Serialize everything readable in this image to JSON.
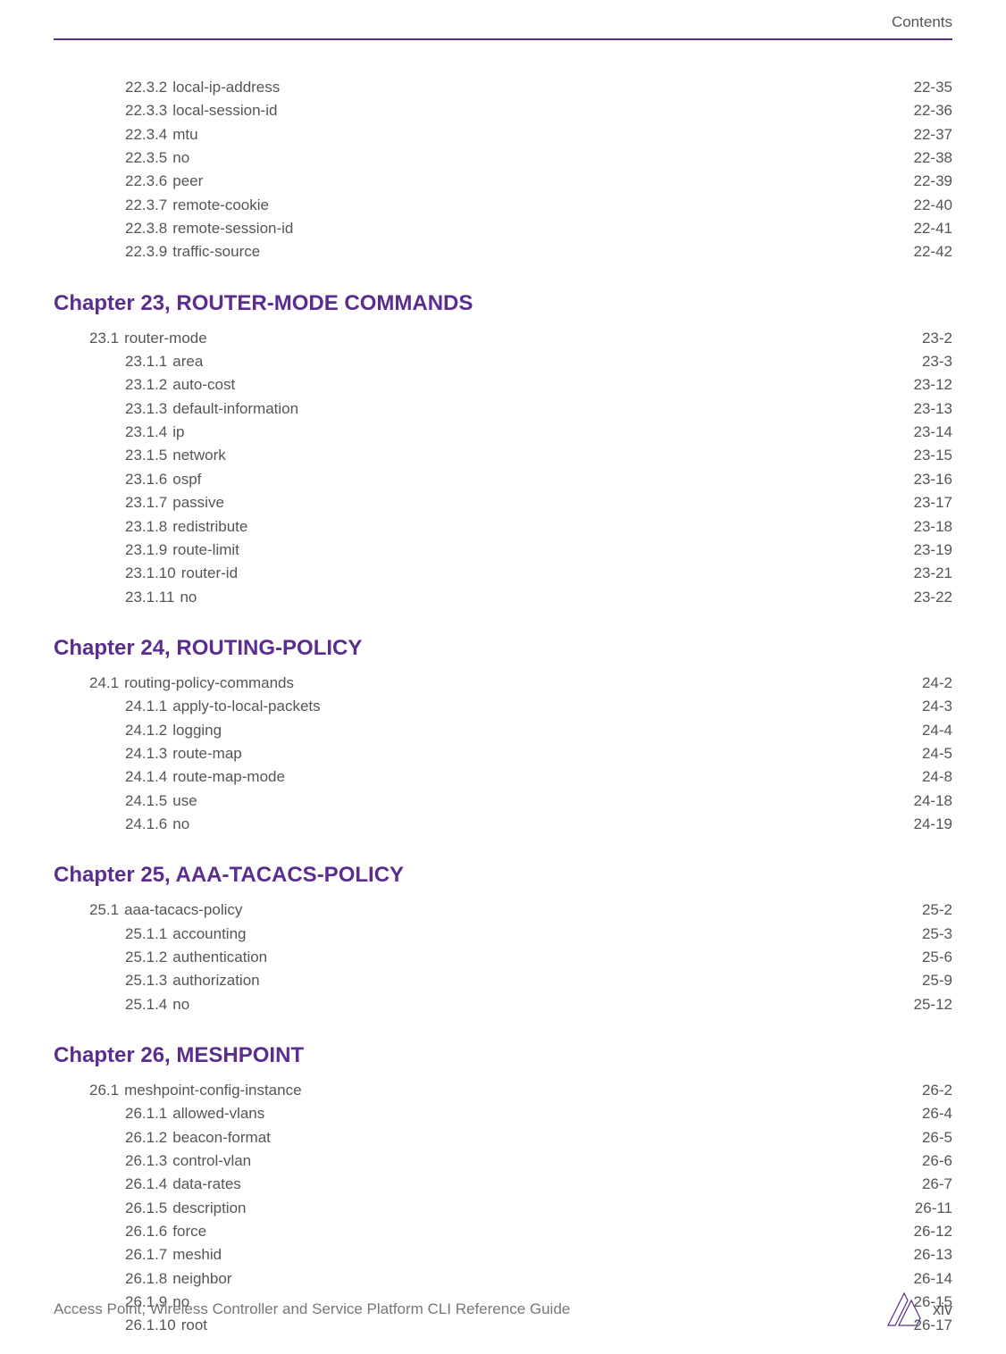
{
  "header": {
    "right": "Contents"
  },
  "footer": {
    "left": "Access Point, Wireless Controller and Service Platform CLI Reference Guide",
    "page": "xiv"
  },
  "orphan_entries": [
    {
      "num": "22.3.2",
      "title": "local-ip-address",
      "page": "22-35"
    },
    {
      "num": "22.3.3",
      "title": "local-session-id",
      "page": "22-36"
    },
    {
      "num": "22.3.4",
      "title": "mtu",
      "page": "22-37"
    },
    {
      "num": "22.3.5",
      "title": "no",
      "page": "22-38"
    },
    {
      "num": "22.3.6",
      "title": "peer",
      "page": "22-39"
    },
    {
      "num": "22.3.7",
      "title": "remote-cookie",
      "page": "22-40"
    },
    {
      "num": "22.3.8",
      "title": "remote-session-id",
      "page": "22-41"
    },
    {
      "num": "22.3.9",
      "title": "traffic-source",
      "page": "22-42"
    }
  ],
  "chapters": [
    {
      "title": "Chapter 23, ROUTER-MODE COMMANDS",
      "entries": [
        {
          "level": 1,
          "num": "23.1",
          "title": "router-mode",
          "page": "23-2"
        },
        {
          "level": 2,
          "num": "23.1.1",
          "title": "area",
          "page": "23-3"
        },
        {
          "level": 2,
          "num": "23.1.2",
          "title": "auto-cost",
          "page": "23-12"
        },
        {
          "level": 2,
          "num": "23.1.3",
          "title": "default-information",
          "page": "23-13"
        },
        {
          "level": 2,
          "num": "23.1.4",
          "title": "ip",
          "page": "23-14"
        },
        {
          "level": 2,
          "num": "23.1.5",
          "title": "network",
          "page": "23-15"
        },
        {
          "level": 2,
          "num": "23.1.6",
          "title": "ospf",
          "page": "23-16"
        },
        {
          "level": 2,
          "num": "23.1.7",
          "title": "passive",
          "page": "23-17"
        },
        {
          "level": 2,
          "num": "23.1.8",
          "title": "redistribute",
          "page": "23-18"
        },
        {
          "level": 2,
          "num": "23.1.9",
          "title": "route-limit",
          "page": "23-19"
        },
        {
          "level": 2,
          "num": "23.1.10",
          "title": "router-id",
          "page": "23-21"
        },
        {
          "level": 2,
          "num": "23.1.11",
          "title": "no",
          "page": "23-22"
        }
      ]
    },
    {
      "title": "Chapter 24, ROUTING-POLICY",
      "entries": [
        {
          "level": 1,
          "num": "24.1",
          "title": "routing-policy-commands",
          "page": "24-2"
        },
        {
          "level": 2,
          "num": "24.1.1",
          "title": "apply-to-local-packets",
          "page": "24-3"
        },
        {
          "level": 2,
          "num": "24.1.2",
          "title": "logging",
          "page": "24-4"
        },
        {
          "level": 2,
          "num": "24.1.3",
          "title": "route-map",
          "page": "24-5"
        },
        {
          "level": 2,
          "num": "24.1.4",
          "title": "route-map-mode",
          "page": "24-8"
        },
        {
          "level": 2,
          "num": "24.1.5",
          "title": "use",
          "page": "24-18"
        },
        {
          "level": 2,
          "num": "24.1.6",
          "title": "no",
          "page": "24-19"
        }
      ]
    },
    {
      "title": "Chapter 25, AAA-TACACS-POLICY",
      "entries": [
        {
          "level": 1,
          "num": "25.1",
          "title": "aaa-tacacs-policy",
          "page": "25-2"
        },
        {
          "level": 2,
          "num": "25.1.1",
          "title": "accounting",
          "page": "25-3"
        },
        {
          "level": 2,
          "num": "25.1.2",
          "title": "authentication",
          "page": "25-6"
        },
        {
          "level": 2,
          "num": "25.1.3",
          "title": "authorization",
          "page": "25-9"
        },
        {
          "level": 2,
          "num": "25.1.4",
          "title": "no",
          "page": "25-12"
        }
      ]
    },
    {
      "title": "Chapter 26, MESHPOINT",
      "entries": [
        {
          "level": 1,
          "num": "26.1",
          "title": "meshpoint-config-instance",
          "page": "26-2"
        },
        {
          "level": 2,
          "num": "26.1.1",
          "title": "allowed-vlans",
          "page": "26-4"
        },
        {
          "level": 2,
          "num": "26.1.2",
          "title": "beacon-format",
          "page": "26-5"
        },
        {
          "level": 2,
          "num": "26.1.3",
          "title": "control-vlan",
          "page": "26-6"
        },
        {
          "level": 2,
          "num": "26.1.4",
          "title": "data-rates",
          "page": "26-7"
        },
        {
          "level": 2,
          "num": "26.1.5",
          "title": "description",
          "page": "26-11"
        },
        {
          "level": 2,
          "num": "26.1.6",
          "title": "force",
          "page": "26-12"
        },
        {
          "level": 2,
          "num": "26.1.7",
          "title": "meshid",
          "page": "26-13"
        },
        {
          "level": 2,
          "num": "26.1.8",
          "title": "neighbor",
          "page": "26-14"
        },
        {
          "level": 2,
          "num": "26.1.9",
          "title": "no",
          "page": "26-15"
        },
        {
          "level": 2,
          "num": "26.1.10",
          "title": "root",
          "page": "26-17"
        }
      ]
    }
  ]
}
